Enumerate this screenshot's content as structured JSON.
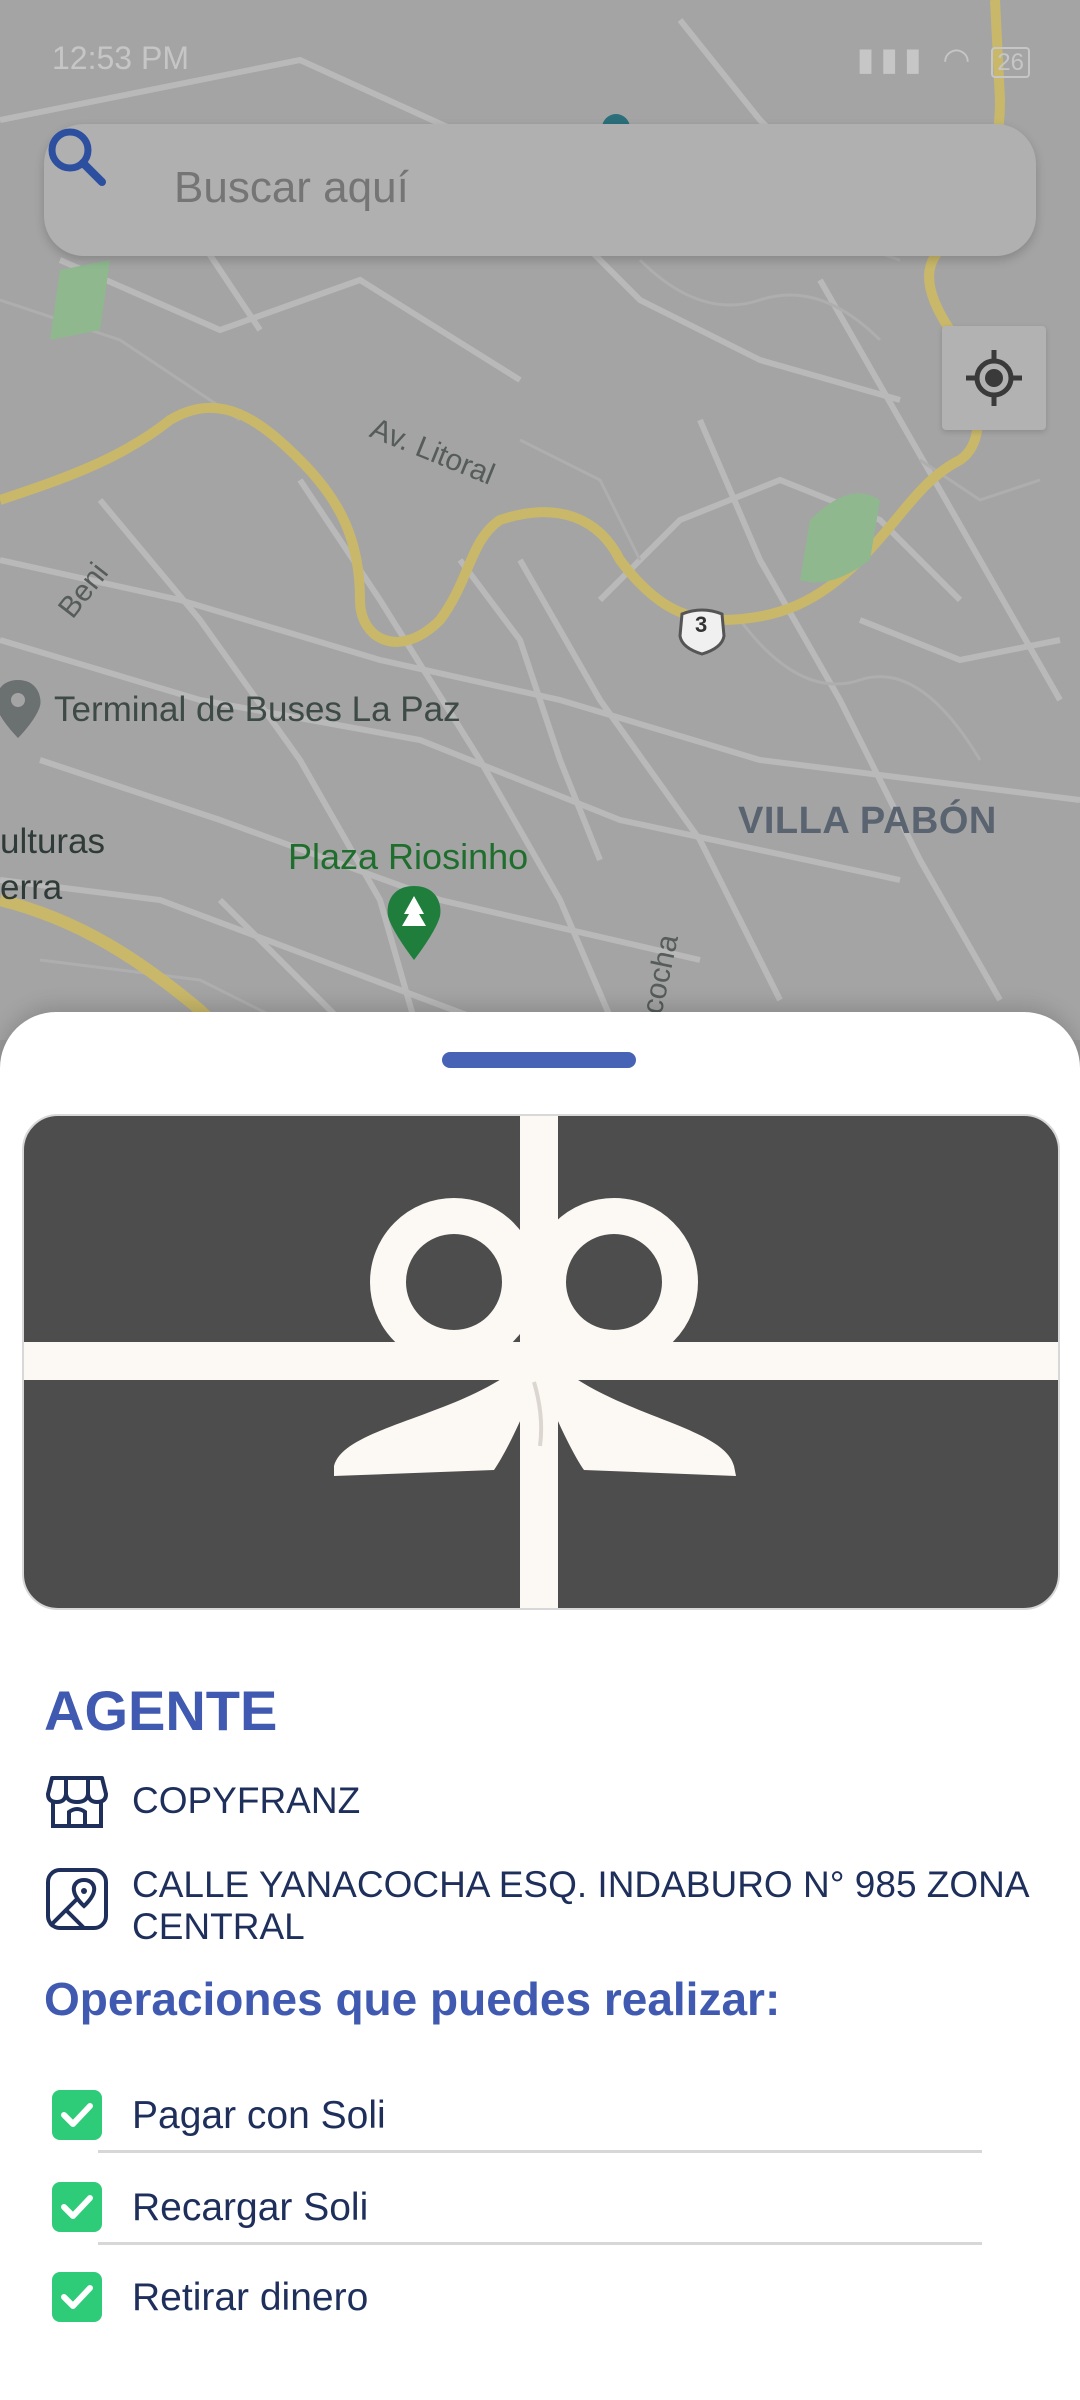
{
  "status_bar": {
    "time": "12:53 PM",
    "battery": "26",
    "icons": "▮▮▮ ◠"
  },
  "search": {
    "placeholder": "Buscar aquí",
    "icon": "search-icon"
  },
  "map": {
    "labels": {
      "street_litoral": "Av. Litoral",
      "street_beni": "Beni",
      "street_cocha": "cocha",
      "route_shield": "3",
      "terminal": "Terminal de Buses La Paz",
      "district": "VILLA PABÓN",
      "park": "Plaza Riosinho",
      "culturas_line1": "ulturas",
      "culturas_line2": "erra"
    },
    "locate_icon": "my-location-icon"
  },
  "agent": {
    "title": "AGENTE",
    "name": "COPYFRANZ",
    "address": "CALLE YANACOCHA ESQ. INDABURO N° 985 ZONA CENTRAL",
    "store_icon": "store-icon",
    "location_icon": "map-pin-icon"
  },
  "operations": {
    "title": "Operaciones que puedes realizar:",
    "items": [
      {
        "label": "Pagar con Soli",
        "checked": true
      },
      {
        "label": "Recargar Soli",
        "checked": true
      },
      {
        "label": "Retirar dinero",
        "checked": true
      }
    ]
  },
  "colors": {
    "accent": "#3f5ab0",
    "text_dark": "#1e2f5c",
    "check_green": "#2ecb78",
    "card_bg": "#4d4d4d"
  }
}
